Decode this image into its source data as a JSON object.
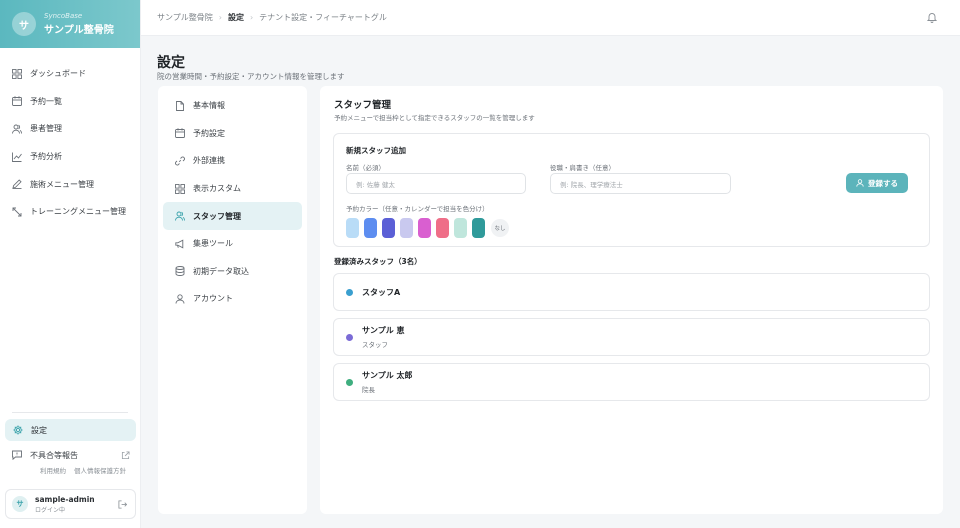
{
  "brand": {
    "initial": "サ",
    "subtitle": "SyncoBase",
    "name": "サンプル整骨院"
  },
  "sidebar": {
    "items": [
      {
        "label": "ダッシュボード",
        "icon": "grid-icon"
      },
      {
        "label": "予約一覧",
        "icon": "calendar-icon"
      },
      {
        "label": "患者管理",
        "icon": "users-icon"
      },
      {
        "label": "予約分析",
        "icon": "chart-icon"
      },
      {
        "label": "施術メニュー管理",
        "icon": "pencil-icon"
      },
      {
        "label": "トレーニングメニュー管理",
        "icon": "expand-icon"
      }
    ],
    "settings_label": "設定",
    "report_label": "不具合等報告",
    "terms_link": "利用規約",
    "privacy_link": "個人情報保護方針",
    "user": {
      "initial": "サ",
      "name": "sample-admin",
      "status": "ログイン中"
    }
  },
  "topbar": {
    "breadcrumb": [
      "サンプル整骨院",
      "設定",
      "テナント設定・フィーチャートグル"
    ]
  },
  "page": {
    "title": "設定",
    "description": "院の営業時間・予約設定・アカウント情報を管理します"
  },
  "settings_menu": [
    {
      "label": "基本情報",
      "icon": "file-icon"
    },
    {
      "label": "予約設定",
      "icon": "calendar-icon"
    },
    {
      "label": "外部連携",
      "icon": "link-icon"
    },
    {
      "label": "表示カスタム",
      "icon": "grid-icon"
    },
    {
      "label": "スタッフ管理",
      "icon": "users-icon",
      "active": true
    },
    {
      "label": "集患ツール",
      "icon": "megaphone-icon"
    },
    {
      "label": "初期データ取込",
      "icon": "database-icon"
    },
    {
      "label": "アカウント",
      "icon": "user-icon"
    }
  ],
  "staff": {
    "title": "スタッフ管理",
    "description": "予約メニューで担当枠として指定できるスタッフの一覧を管理します",
    "add_form": {
      "title": "新規スタッフ追加",
      "name_label": "名前（必須）",
      "name_placeholder": "例: 佐藤 健太",
      "role_label": "役職・肩書き（任意）",
      "role_placeholder": "例: 院長、理学療法士",
      "register_label": "登録する",
      "color_label": "予約カラー（任意・カレンダーで担当を色分け）",
      "colors": [
        "#b9dcf7",
        "#5d8df0",
        "#5b5fd6",
        "#c9c9ef",
        "#d95fd0",
        "#ef6e88",
        "#bfe6dc",
        "#2f9a9a"
      ],
      "none_label": "なし"
    },
    "list_title": "登録済みスタッフ（3名）",
    "members": [
      {
        "name": "スタッフA",
        "role": "",
        "color": "#3a9fcf"
      },
      {
        "name": "サンプル 恵",
        "role": "スタッフ",
        "color": "#7b6bd6"
      },
      {
        "name": "サンプル 太郎",
        "role": "院長",
        "color": "#3fae7f"
      }
    ]
  }
}
